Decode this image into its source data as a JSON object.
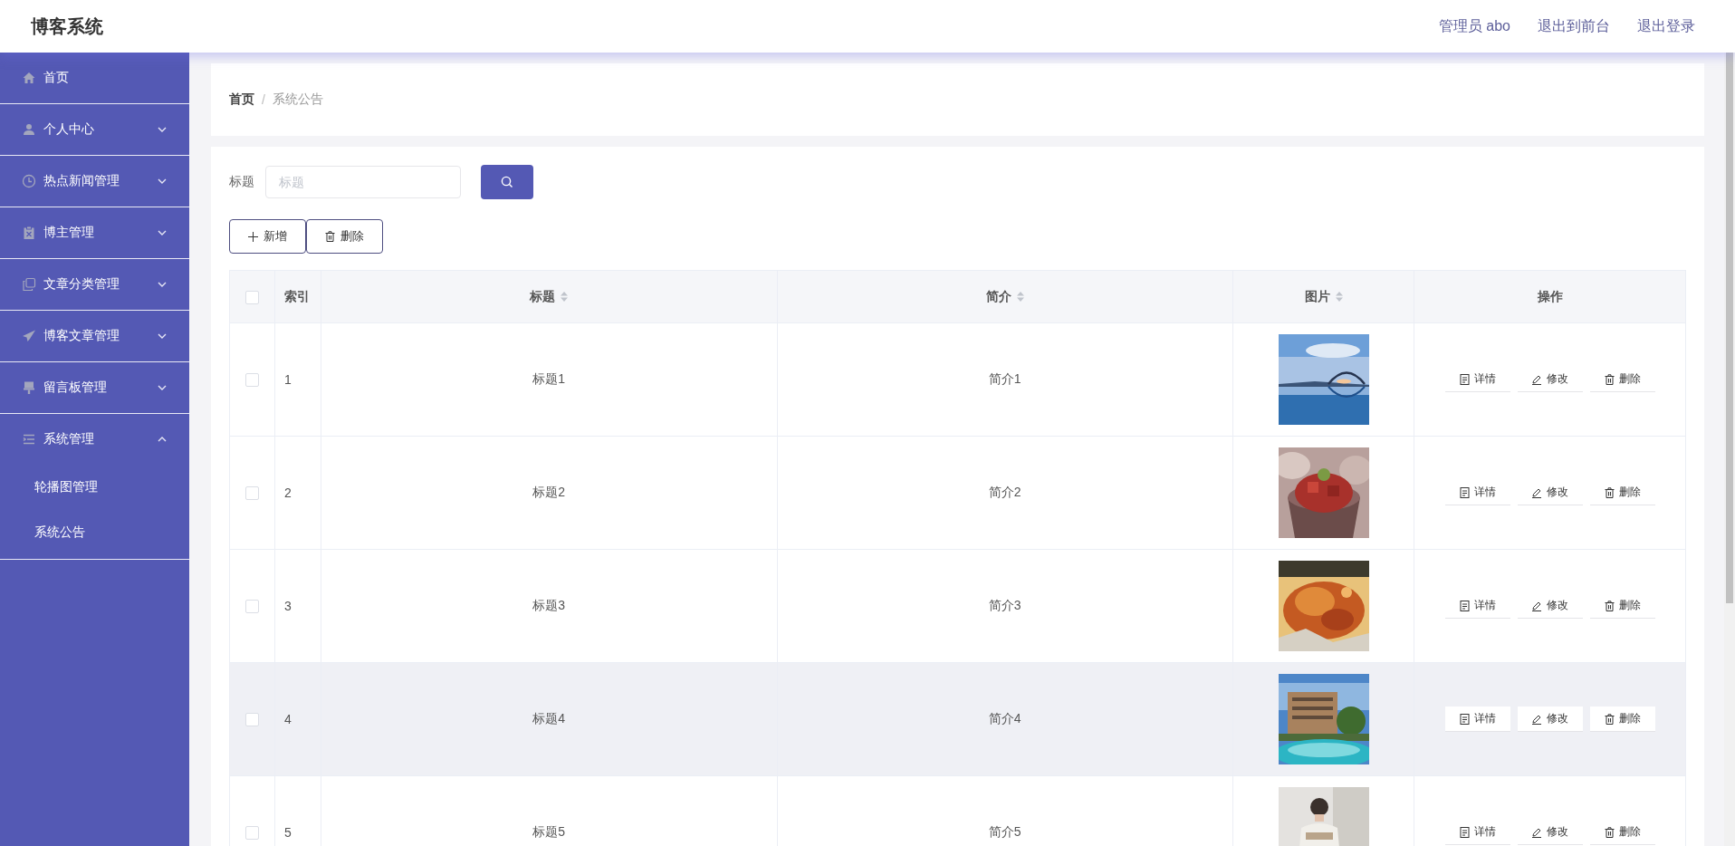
{
  "header": {
    "title": "博客系统",
    "links": [
      "管理员 abo",
      "退出到前台",
      "退出登录"
    ]
  },
  "sidebar": {
    "items": [
      {
        "label": "首页"
      },
      {
        "label": "个人中心",
        "expanded": false
      },
      {
        "label": "热点新闻管理",
        "expanded": false
      },
      {
        "label": "博主管理",
        "expanded": false
      },
      {
        "label": "文章分类管理",
        "expanded": false
      },
      {
        "label": "博客文章管理",
        "expanded": false
      },
      {
        "label": "留言板管理",
        "expanded": false
      },
      {
        "label": "系统管理",
        "expanded": true,
        "children": [
          {
            "label": "轮播图管理"
          },
          {
            "label": "系统公告"
          }
        ]
      }
    ]
  },
  "breadcrumb": {
    "items": [
      "首页",
      "系统公告"
    ],
    "separator": "/"
  },
  "search": {
    "label": "标题",
    "placeholder": "标题"
  },
  "toolbar": {
    "buttons": [
      {
        "kind": "add",
        "label": "新增"
      },
      {
        "kind": "delete",
        "label": "删除"
      }
    ]
  },
  "table": {
    "select_all_checked": false,
    "columns": [
      {
        "label": "索引",
        "sortable": false
      },
      {
        "label": "标题",
        "sortable": true
      },
      {
        "label": "简介",
        "sortable": true
      },
      {
        "label": "图片",
        "sortable": true
      },
      {
        "label": "操作",
        "sortable": false
      }
    ],
    "rows": [
      {
        "checked": false,
        "hovered": false,
        "index": "1",
        "title": "标题1",
        "intro": "简介1",
        "actions": [
          {
            "kind": "detail",
            "label": "详情"
          },
          {
            "kind": "edit",
            "label": "修改"
          },
          {
            "kind": "delete",
            "label": "删除"
          }
        ]
      },
      {
        "checked": false,
        "hovered": false,
        "index": "2",
        "title": "标题2",
        "intro": "简介2",
        "actions": [
          {
            "kind": "detail",
            "label": "详情"
          },
          {
            "kind": "edit",
            "label": "修改"
          },
          {
            "kind": "delete",
            "label": "删除"
          }
        ]
      },
      {
        "checked": false,
        "hovered": false,
        "index": "3",
        "title": "标题3",
        "intro": "简介3",
        "actions": [
          {
            "kind": "detail",
            "label": "详情"
          },
          {
            "kind": "edit",
            "label": "修改"
          },
          {
            "kind": "delete",
            "label": "删除"
          }
        ]
      },
      {
        "checked": false,
        "hovered": true,
        "index": "4",
        "title": "标题4",
        "intro": "简介4",
        "actions": [
          {
            "kind": "detail",
            "label": "详情"
          },
          {
            "kind": "edit",
            "label": "修改"
          },
          {
            "kind": "delete",
            "label": "删除"
          }
        ]
      },
      {
        "checked": false,
        "hovered": false,
        "index": "5",
        "title": "标题5",
        "intro": "简介5",
        "actions": [
          {
            "kind": "detail",
            "label": "详情"
          },
          {
            "kind": "edit",
            "label": "修改"
          },
          {
            "kind": "delete",
            "label": "删除"
          }
        ]
      }
    ]
  }
}
